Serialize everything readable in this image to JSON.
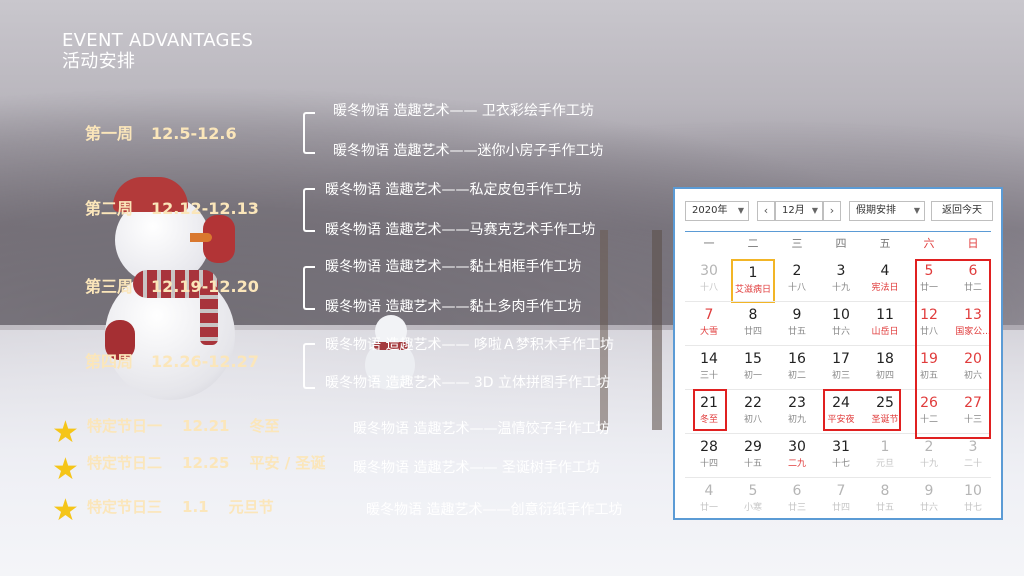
{
  "title": "EVENT ADVANTAGES　活动安排",
  "weeks": [
    {
      "label": "第一周",
      "date": "12.5-12.6",
      "acts": [
        "暖冬物语 造趣艺术—— 卫衣彩绘手作工坊",
        "暖冬物语 造趣艺术——迷你小房子手作工坊"
      ]
    },
    {
      "label": "第二周",
      "date": "12.12-12.13",
      "acts": [
        "暖冬物语 造趣艺术——私定皮包手作工坊",
        "暖冬物语 造趣艺术——马赛克艺术手作工坊"
      ]
    },
    {
      "label": "第三周",
      "date": "12.19-12.20",
      "acts": [
        "暖冬物语 造趣艺术——黏土相框手作工坊",
        "暖冬物语 造趣艺术——黏土多肉手作工坊"
      ]
    },
    {
      "label": "第四周",
      "date": "12.26-12.27",
      "acts": [
        "暖冬物语 造趣艺术—— 哆啦Ａ梦积木手作工坊",
        "暖冬物语 造趣艺术—— 3D 立体拼图手作工坊"
      ]
    }
  ],
  "holidays": [
    {
      "label": "特定节日一",
      "date": "12.21",
      "name": "冬至",
      "act": "暖冬物语 造趣艺术——温情饺子手作工坊"
    },
    {
      "label": "特定节日二",
      "date": "12.25",
      "name": "平安 / 圣诞",
      "act": "暖冬物语 造趣艺术—— 圣诞树手作工坊"
    },
    {
      "label": "特定节日三",
      "date": "1.1",
      "name": "元旦节",
      "act": "暖冬物语 造趣艺术——创意衍纸手作工坊"
    }
  ],
  "calendar": {
    "year": "2020年",
    "month": "12月",
    "holiday_select": "假期安排",
    "today_button": "返回今天",
    "weekdays": [
      "一",
      "二",
      "三",
      "四",
      "五",
      "六",
      "日"
    ],
    "rows": [
      [
        {
          "n": "30",
          "l": "十八"
        },
        {
          "n": "1",
          "l": "艾滋病日"
        },
        {
          "n": "2",
          "l": "十八"
        },
        {
          "n": "3",
          "l": "十九"
        },
        {
          "n": "4",
          "l": "宪法日"
        },
        {
          "n": "5",
          "l": "廿一"
        },
        {
          "n": "6",
          "l": "廿二"
        }
      ],
      [
        {
          "n": "7",
          "l": "大雪"
        },
        {
          "n": "8",
          "l": "廿四"
        },
        {
          "n": "9",
          "l": "廿五"
        },
        {
          "n": "10",
          "l": "廿六"
        },
        {
          "n": "11",
          "l": "山岳日"
        },
        {
          "n": "12",
          "l": "廿八"
        },
        {
          "n": "13",
          "l": "国家公..."
        }
      ],
      [
        {
          "n": "14",
          "l": "三十"
        },
        {
          "n": "15",
          "l": "初一"
        },
        {
          "n": "16",
          "l": "初二"
        },
        {
          "n": "17",
          "l": "初三"
        },
        {
          "n": "18",
          "l": "初四"
        },
        {
          "n": "19",
          "l": "初五"
        },
        {
          "n": "20",
          "l": "初六"
        }
      ],
      [
        {
          "n": "21",
          "l": "冬至"
        },
        {
          "n": "22",
          "l": "初八"
        },
        {
          "n": "23",
          "l": "初九"
        },
        {
          "n": "24",
          "l": "平安夜"
        },
        {
          "n": "25",
          "l": "圣诞节"
        },
        {
          "n": "26",
          "l": "十二"
        },
        {
          "n": "27",
          "l": "十三"
        }
      ],
      [
        {
          "n": "28",
          "l": "十四"
        },
        {
          "n": "29",
          "l": "十五"
        },
        {
          "n": "30",
          "l": "二九"
        },
        {
          "n": "31",
          "l": "十七"
        },
        {
          "n": "1",
          "l": "元旦"
        },
        {
          "n": "2",
          "l": "十九"
        },
        {
          "n": "3",
          "l": "二十"
        }
      ],
      [
        {
          "n": "4",
          "l": "廿一"
        },
        {
          "n": "5",
          "l": "小寒"
        },
        {
          "n": "6",
          "l": "廿三"
        },
        {
          "n": "7",
          "l": "廿四"
        },
        {
          "n": "8",
          "l": "廿五"
        },
        {
          "n": "9",
          "l": "廿六"
        },
        {
          "n": "10",
          "l": "廿七"
        }
      ]
    ]
  },
  "colors": {
    "label": "#fbe6ba",
    "star": "#f5c518",
    "calendar_border": "#5b9bd5",
    "highlight_box": "#e02020",
    "today_box": "#f2b526"
  }
}
